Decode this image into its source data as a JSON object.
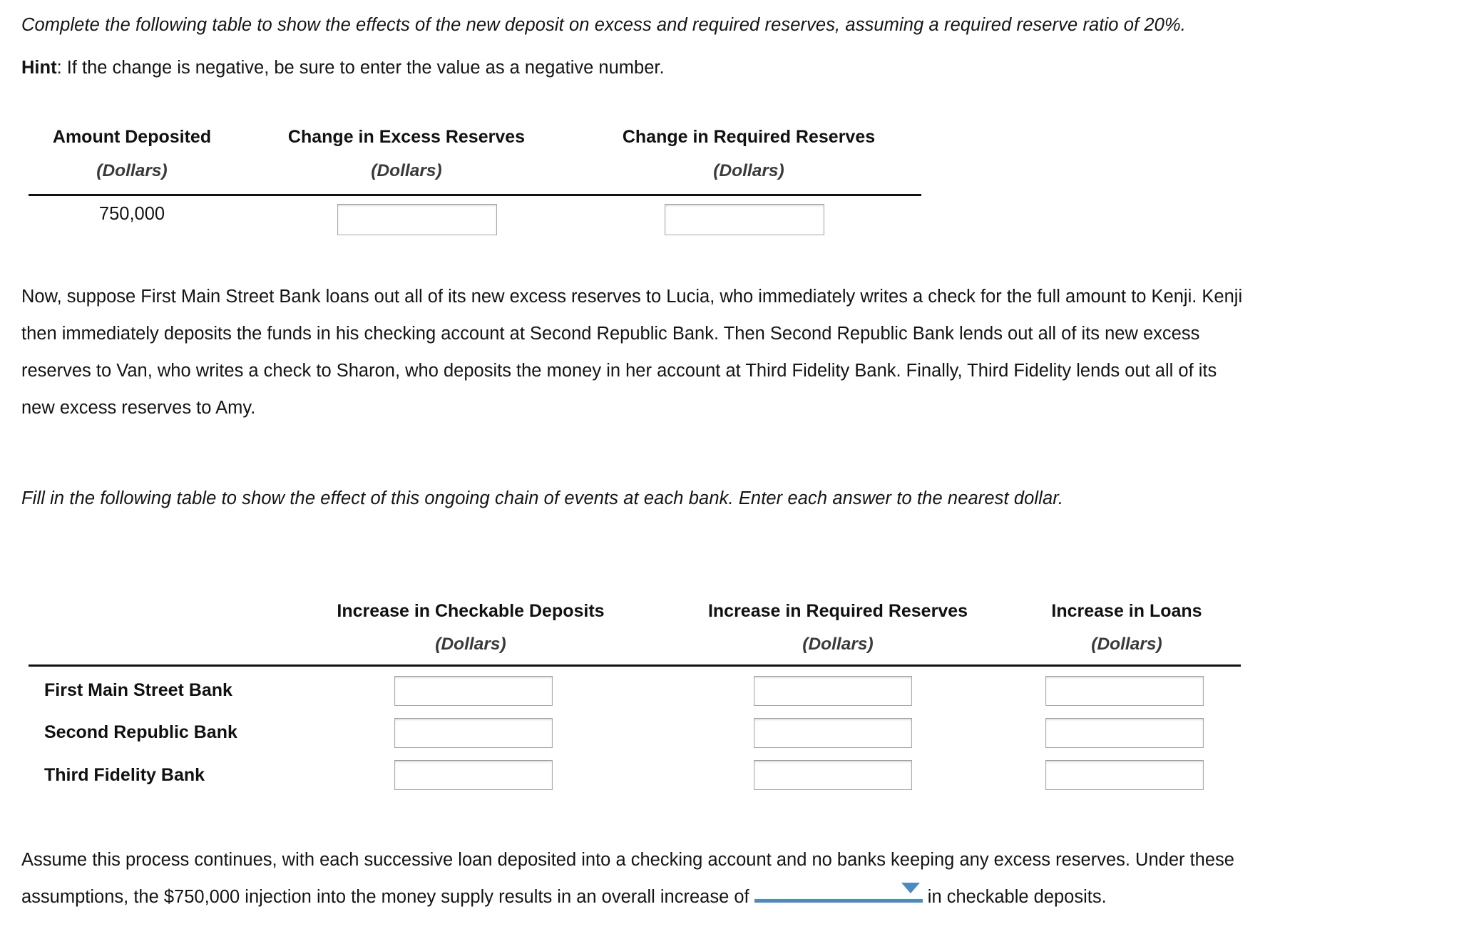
{
  "intro": {
    "instruction": "Complete the following table to show the effects of the new deposit on excess and required reserves, assuming a required reserve ratio of 20%.",
    "hint_label": "Hint",
    "hint_text": ": If the change is negative, be sure to enter the value as a negative number."
  },
  "table1": {
    "headers": [
      {
        "title": "Amount Deposited",
        "unit": "(Dollars)"
      },
      {
        "title": "Change in Excess Reserves",
        "unit": "(Dollars)"
      },
      {
        "title": "Change in Required Reserves",
        "unit": "(Dollars)"
      }
    ],
    "row": {
      "amount_deposited": "750,000",
      "change_excess_reserves": "",
      "change_required_reserves": ""
    }
  },
  "narrative": {
    "line1": "Now, suppose First Main Street Bank loans out all of its new excess reserves to Lucia, who immediately writes a check for the full amount to Kenji. Kenji",
    "line2": "then immediately deposits the funds in his checking account at Second Republic Bank. Then Second Republic Bank lends out all of its new excess",
    "line3": "reserves to Van, who writes a check to Sharon, who deposits the money in her account at Third Fidelity Bank. Finally, Third Fidelity lends out all of its",
    "line4": "new excess reserves to Amy."
  },
  "instruction2": "Fill in the following table to show the effect of this ongoing chain of events at each bank. Enter each answer to the nearest dollar.",
  "table2": {
    "headers": [
      {
        "title": "Increase in Checkable Deposits",
        "unit": "(Dollars)"
      },
      {
        "title": "Increase in Required Reserves",
        "unit": "(Dollars)"
      },
      {
        "title": "Increase in Loans",
        "unit": "(Dollars)"
      }
    ],
    "rows": [
      {
        "label": "First Main Street Bank",
        "checkable_deposits": "",
        "required_reserves": "",
        "loans": ""
      },
      {
        "label": "Second Republic Bank",
        "checkable_deposits": "",
        "required_reserves": "",
        "loans": ""
      },
      {
        "label": "Third Fidelity Bank",
        "checkable_deposits": "",
        "required_reserves": "",
        "loans": ""
      }
    ]
  },
  "closing": {
    "line1": "Assume this process continues, with each successive loan deposited into a checking account and no banks keeping any excess reserves. Under these",
    "line2_before": "assumptions, the $750,000 injection into the money supply results in an overall increase of",
    "dropdown_value": "",
    "line2_after": "in checkable deposits."
  },
  "colors": {
    "accent": "#4a8cc2",
    "rule": "#111111",
    "input_border": "#a9a9a9",
    "text": "#141414"
  }
}
